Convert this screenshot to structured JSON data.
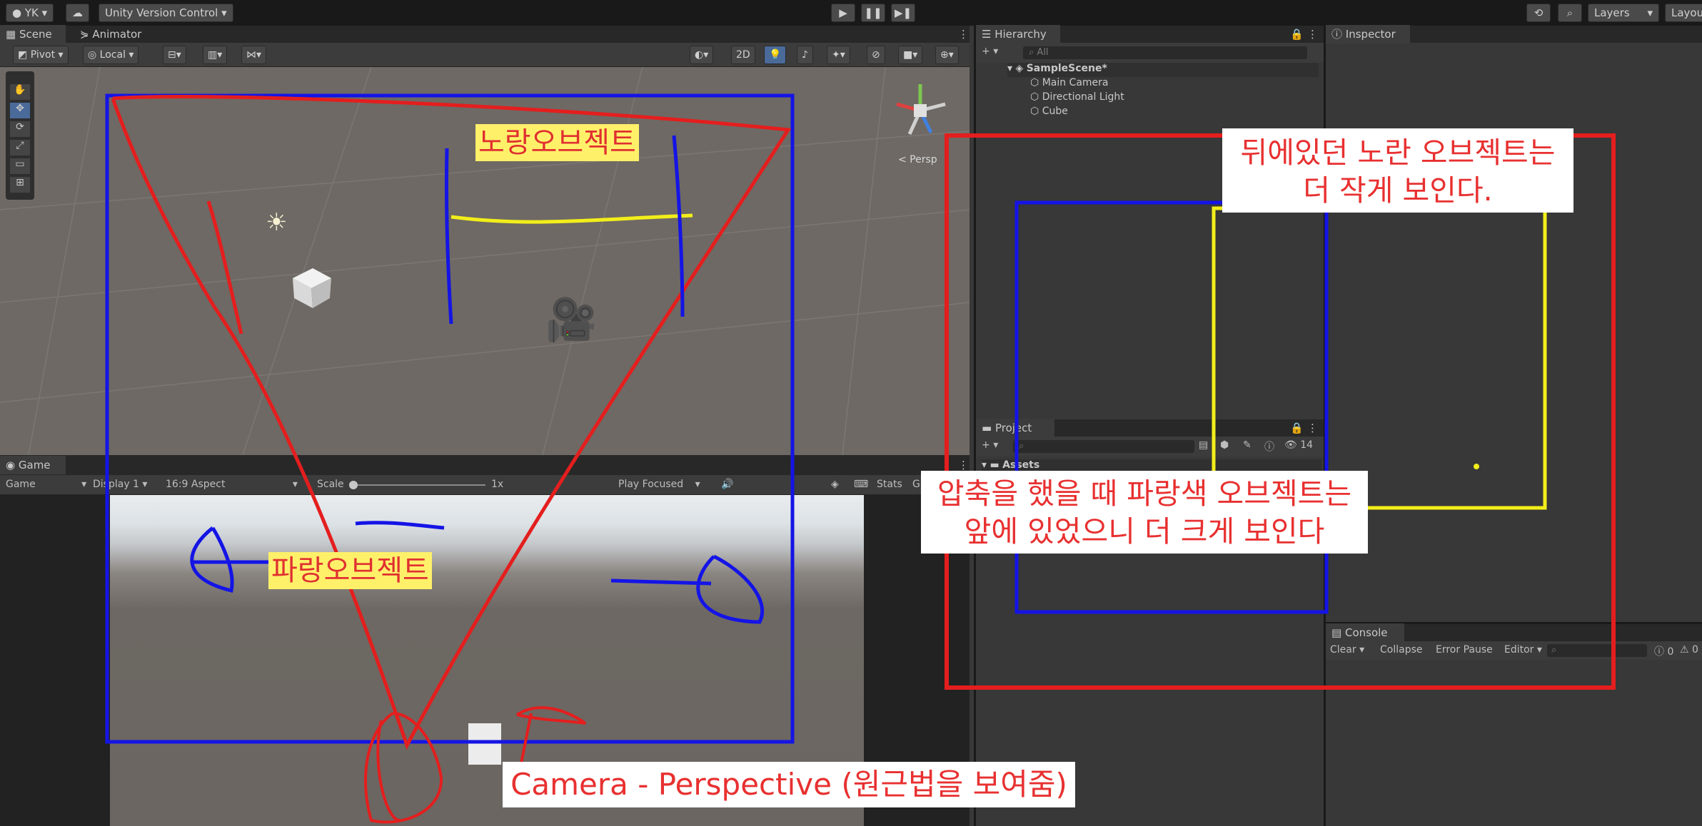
{
  "topbar": {
    "account": "YK",
    "version_control": "Unity Version Control",
    "layers": "Layers",
    "layout": "Layout"
  },
  "scene_panel": {
    "tabs": [
      "Scene",
      "Animator"
    ],
    "pivot": "Pivot",
    "local": "Local",
    "mode_2d": "2D",
    "persp_label": "< Persp"
  },
  "game_panel": {
    "tab": "Game",
    "game_dropdown": "Game",
    "display": "Display 1",
    "aspect": "16:9 Aspect",
    "scale_label": "Scale",
    "scale_value": "1x",
    "play_focused": "Play Focused",
    "stats": "Stats",
    "gizmos": "G"
  },
  "hierarchy": {
    "tab": "Hierarchy",
    "search_placeholder": "All",
    "scene": "SampleScene*",
    "items": [
      "Main Camera",
      "Directional Light",
      "Cube"
    ]
  },
  "inspector": {
    "tab": "Inspector"
  },
  "project": {
    "tab": "Project",
    "assets": "Assets",
    "count": "14"
  },
  "console": {
    "tab": "Console",
    "clear": "Clear",
    "collapse": "Collapse",
    "error_pause": "Error Pause",
    "editor": "Editor",
    "count_a": "0",
    "count_b": "0"
  },
  "annotations": {
    "yellow_object": "노랑오브젝트",
    "blue_object": "파랑오브젝트",
    "far_note_line1": "뒤에있던 노란 오브젝트는",
    "far_note_line2": "더 작게 보인다.",
    "near_note_line1": "압축을 했을 때 파랑색 오브젝트는",
    "near_note_line2": "앞에 있었으니 더 크게 보인다",
    "title": "Camera - Perspective (원근법을 보여줌)"
  },
  "colors": {
    "annotation_red": "#e41e1e",
    "annotation_blue": "#1414e6",
    "annotation_yellow": "#f2ee1a",
    "scene_bg": "#6e6964",
    "editor_bg": "#383838"
  }
}
